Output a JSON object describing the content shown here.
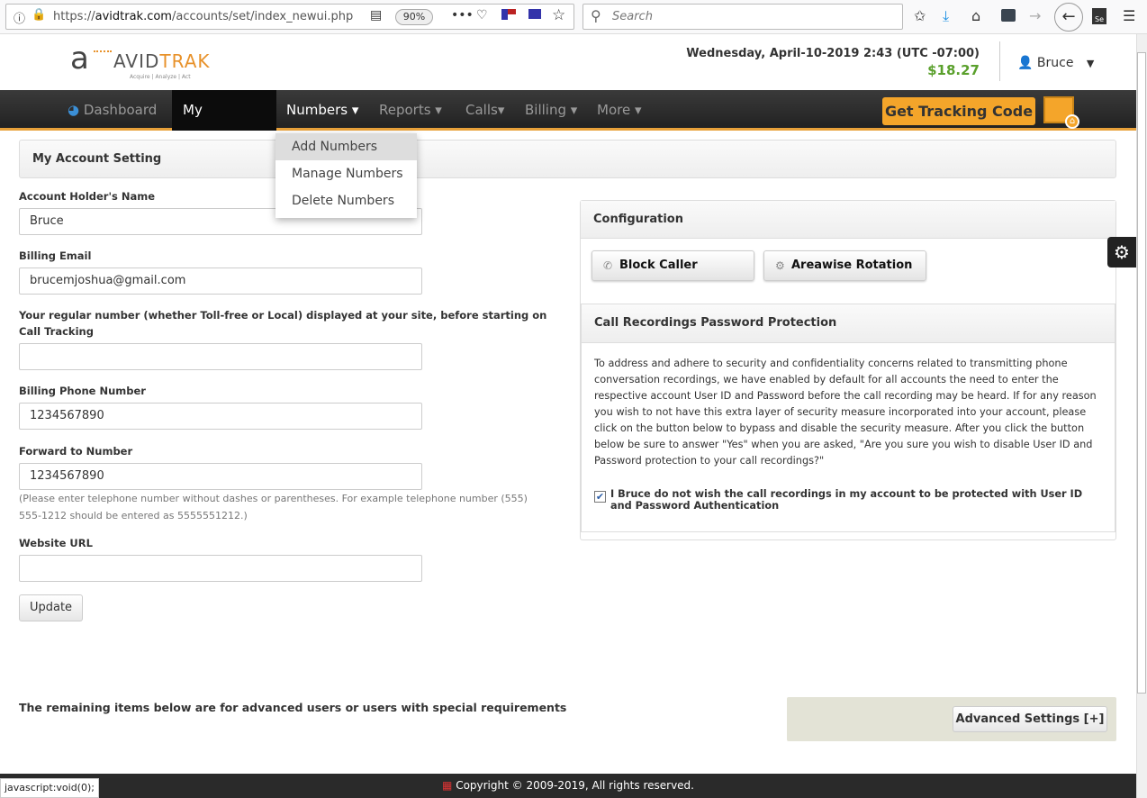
{
  "browser": {
    "url_prefix": "https://",
    "url_domain": "avidtrak.com",
    "url_path": "/accounts/set/index_newui.php",
    "zoom": "90%",
    "search_placeholder": "Search"
  },
  "header": {
    "logo_text": "AVIDTRAK",
    "logo_tagline": "Acquire | Analyze | Act",
    "datetime": "Wednesday, April-10-2019 2:43 (UTC -07:00)",
    "balance": "$18.27",
    "user": "Bruce",
    "balance_color": "#5aa02c"
  },
  "nav": {
    "items": [
      {
        "label": "Dashboard"
      },
      {
        "label": "My Account▾"
      },
      {
        "label": "Numbers ▾"
      },
      {
        "label": "Reports ▾"
      },
      {
        "label": "Calls▾"
      },
      {
        "label": "Billing ▾"
      },
      {
        "label": "More ▾"
      }
    ],
    "tracking_button": "Get Tracking Code",
    "accent": "#f4a52a"
  },
  "dropdown": {
    "items": [
      "Add Numbers",
      "Manage Numbers",
      "Delete Numbers"
    ]
  },
  "account": {
    "title": "My Account Setting",
    "fields": [
      {
        "label": "Account Holder's Name",
        "value": "Bruce"
      },
      {
        "label": "Billing Email",
        "value": "brucemjoshua@gmail.com"
      },
      {
        "label": "Your regular number (whether Toll-free or Local) displayed at your site, before starting on Call Tracking",
        "value": ""
      },
      {
        "label": "Billing Phone Number",
        "value": "1234567890"
      },
      {
        "label": "Forward to Number",
        "value": "1234567890"
      },
      {
        "label": "Website URL",
        "value": ""
      }
    ],
    "hint": "(Please enter telephone number without dashes or parentheses. For example telephone number (555) 555-1212 should be entered as 5555551212.)",
    "update_button": "Update"
  },
  "config": {
    "title": "Configuration",
    "block_caller": "Block Caller",
    "areawise_rotation": "Areawise Rotation"
  },
  "recordings": {
    "title": "Call Recordings Password Protection",
    "text": "To address and adhere to security and confidentiality concerns related to transmitting phone conversation recordings, we have enabled by default for all accounts the need to enter the respective account User ID and Password before the call recording may be heard. If for any reason you wish to not have this extra layer of security measure incorporated into your account, please click on the button below to bypass and disable the security measure. After you click the button below be sure to answer \"Yes\" when you are asked, \"Are you sure you wish to disable User ID and Password protection to your call recordings?\"",
    "checkbox_label": "I Bruce do not wish the call recordings in my account to be protected with User ID and Password Authentication",
    "checked": true
  },
  "advanced": {
    "note": "The remaining items below are for advanced users or users with special requirements",
    "button": "Advanced Settings [+]"
  },
  "footer": {
    "copyright": "Copyright © 2009-2019, All rights reserved."
  },
  "status": {
    "text": "javascript:void(0);"
  }
}
